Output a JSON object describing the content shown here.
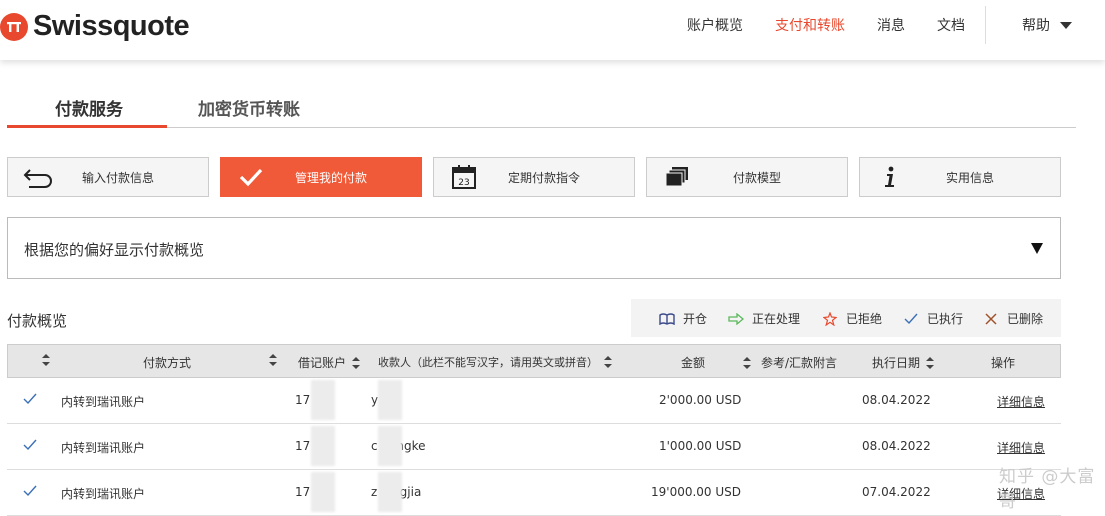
{
  "brand": {
    "name": "Swissquote",
    "color": "#e8492e"
  },
  "nav": {
    "items": [
      {
        "label": "账户概览",
        "active": false
      },
      {
        "label": "支付和转账",
        "active": true
      },
      {
        "label": "消息",
        "active": false
      },
      {
        "label": "文档",
        "active": false
      }
    ],
    "help_label": "帮助"
  },
  "tabs": [
    {
      "label": "付款服务",
      "active": true
    },
    {
      "label": "加密货币转账",
      "active": false
    }
  ],
  "actions": [
    {
      "label": "输入付款信息",
      "icon": "back-arrow-icon",
      "active": false
    },
    {
      "label": "管理我的付款",
      "icon": "checkmark-icon",
      "active": true
    },
    {
      "label": "定期付款指令",
      "icon": "calendar-icon",
      "active": false,
      "icon_text": "23"
    },
    {
      "label": "付款模型",
      "icon": "stacked-pages-icon",
      "active": false
    },
    {
      "label": "实用信息",
      "icon": "info-icon",
      "active": false
    }
  ],
  "filter": {
    "selected": "根据您的偏好显示付款概览"
  },
  "overview": {
    "title": "付款概览",
    "legend": [
      {
        "label": "开仓",
        "icon": "open-book-icon"
      },
      {
        "label": "正在处理",
        "icon": "arrow-right-icon"
      },
      {
        "label": "已拒绝",
        "icon": "star-burst-icon"
      },
      {
        "label": "已执行",
        "icon": "checkmark-icon"
      },
      {
        "label": "已删除",
        "icon": "x-icon"
      }
    ]
  },
  "table": {
    "headers": {
      "status": "",
      "method": "付款方式",
      "debit_account": "借记账户",
      "recipient": "收款人（此栏不能写汉字，请用英文或拼音）",
      "amount": "金额",
      "reference": "参考/汇款附言",
      "exec_date": "执行日期",
      "action": "操作"
    },
    "rows": [
      {
        "method": "内转到瑞讯账户",
        "debit_account": "17     39",
        "recipient": "y      u",
        "amount": "2'000.00 USD",
        "exec_date": "08.04.2022",
        "action": "详细信息"
      },
      {
        "method": "内转到瑞讯账户",
        "debit_account": "17     39",
        "recipient": "c      hongke",
        "amount": "1'000.00 USD",
        "exec_date": "08.04.2022",
        "action": "详细信息"
      },
      {
        "method": "内转到瑞讯账户",
        "debit_account": "17     39",
        "recipient": "z      dingjia",
        "amount": "19'000.00 USD",
        "exec_date": "07.04.2022",
        "action": "详细信息"
      }
    ]
  },
  "watermark": "知乎 @大富哥"
}
